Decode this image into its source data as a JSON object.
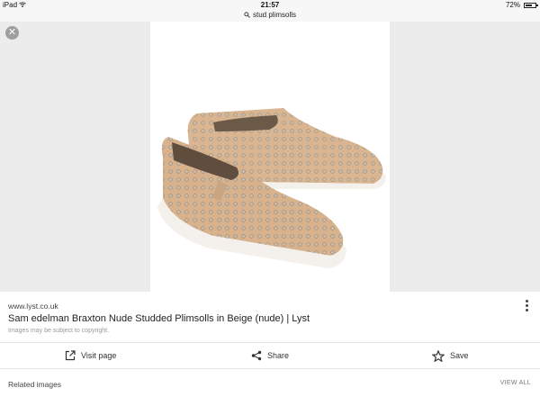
{
  "status": {
    "device": "iPad",
    "time": "21:57",
    "battery": "72%",
    "battery_level": 0.72
  },
  "search": {
    "query": "stud plimsolls"
  },
  "result": {
    "domain": "www.lyst.co.uk",
    "title": "Sam edelman Braxton Nude Studded Plimsolls in Beige (nude) | Lyst",
    "copyright": "Images may be subject to copyright."
  },
  "actions": {
    "visit": "Visit page",
    "share": "Share",
    "save": "Save"
  },
  "related": {
    "label": "Related images",
    "view_all": "VIEW ALL"
  },
  "colors": {
    "shoe_suede": "#d9b591",
    "stud": "#cfc6b8",
    "sole": "#f4f1ec"
  }
}
